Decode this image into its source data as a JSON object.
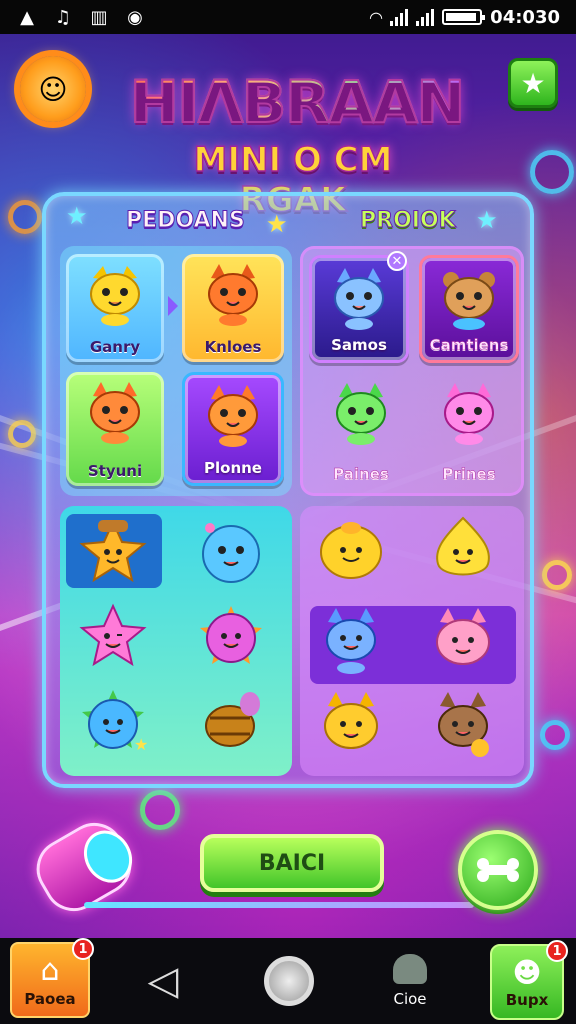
{
  "status_bar": {
    "left_icons": [
      "warning-icon",
      "music-icon",
      "notes-icon",
      "sync-icon"
    ],
    "time": "04:030"
  },
  "header": {
    "title": "HIΛBRAAN",
    "subtitle": "MINI O CM RGAK"
  },
  "board": {
    "tabs": [
      {
        "label": "PEDOANS"
      },
      {
        "label": "PROIOK"
      }
    ],
    "left_top_cards": [
      {
        "label": "Ganry",
        "pet": "yellow-cat-icon"
      },
      {
        "label": "Knloes",
        "pet": "orange-cat-icon"
      },
      {
        "label": "Styuni",
        "pet": "orange-kitten-icon"
      },
      {
        "label": "Plonne",
        "pet": "orange-fox-icon"
      }
    ],
    "right_top_cards": [
      {
        "label": "Samos",
        "pet": "blue-cat-icon"
      },
      {
        "label": "Camtiens",
        "pet": "brown-bear-icon"
      },
      {
        "label": "Paines",
        "pet": "green-cat-icon"
      },
      {
        "label": "Prines",
        "pet": "pink-cat-icon"
      }
    ],
    "left_bottom_items": [
      "star-hat-icon",
      "blue-blob-icon",
      "pink-star-icon",
      "pink-blob-icon",
      "teal-star-icon",
      "barrel-icon"
    ],
    "right_bottom_items": [
      "yellow-blob-icon",
      "yellow-drop-icon",
      "blue-cat-icon",
      "pink-pig-icon",
      "yellow-cat-icon",
      "brown-cat-icon"
    ]
  },
  "controls": {
    "back_label": "BAICI",
    "play_icon": "bone-icon"
  },
  "nav": {
    "home_label": "Paoea",
    "home_badge": "1",
    "clos_label": "Cioe",
    "bupx_label": "Bupx",
    "bupx_badge": "1"
  },
  "colors": {
    "accent_green": "#42c52a",
    "accent_orange": "#f06a1a",
    "board_border": "#7ad8ff"
  }
}
